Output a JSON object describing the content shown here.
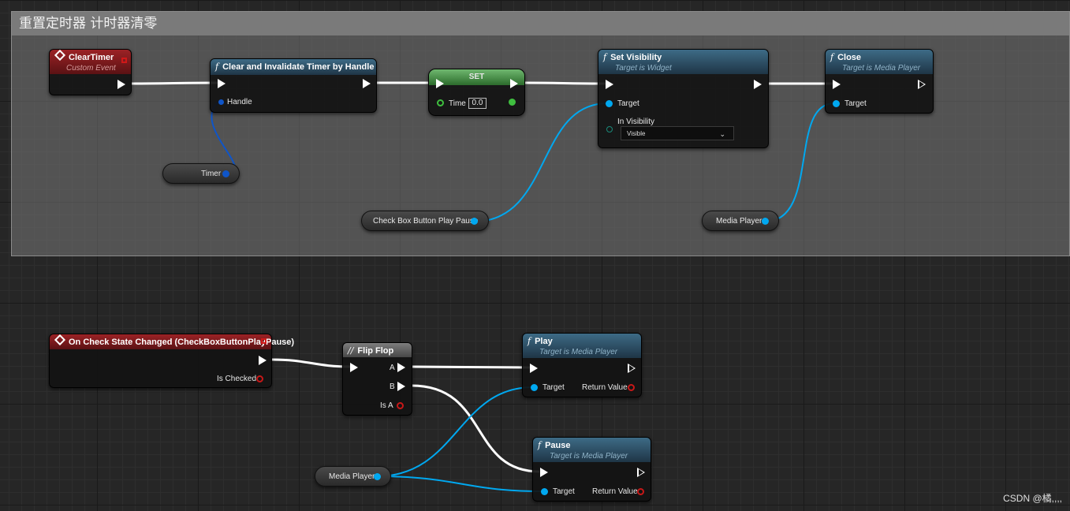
{
  "comment": {
    "title": "重置定时器 计时器清零"
  },
  "nodes": {
    "clear_timer": {
      "title": "ClearTimer",
      "subtitle": "Custom Event"
    },
    "clear_invalidate": {
      "title": "Clear and Invalidate Timer by Handle",
      "handle_label": "Handle"
    },
    "timer_var": {
      "label": "Timer"
    },
    "set_node": {
      "title": "SET",
      "time_label": "Time",
      "time_value": "0.0"
    },
    "set_visibility": {
      "title": "Set Visibility",
      "subtitle": "Target is Widget",
      "target_label": "Target",
      "in_visibility_label": "In Visibility",
      "in_visibility_value": "Visible"
    },
    "checkbox_var": {
      "label": "Check Box Button Play Pause"
    },
    "close_node": {
      "title": "Close",
      "subtitle": "Target is Media Player",
      "target_label": "Target"
    },
    "media_player_var_top": {
      "label": "Media Player"
    },
    "on_check_state": {
      "title": "On Check State Changed (CheckBoxButtonPlayPause)",
      "is_checked_label": "Is Checked"
    },
    "flip_flop": {
      "title": "Flip Flop",
      "a_label": "A",
      "b_label": "B",
      "is_a_label": "Is A"
    },
    "play_node": {
      "title": "Play",
      "subtitle": "Target is Media Player",
      "target_label": "Target",
      "return_label": "Return Value"
    },
    "pause_node": {
      "title": "Pause",
      "subtitle": "Target is Media Player",
      "target_label": "Target",
      "return_label": "Return Value"
    },
    "media_player_var_bottom": {
      "label": "Media Player"
    }
  },
  "icons": {
    "function": "f",
    "event": "diamond",
    "macro": "//"
  },
  "colors": {
    "exec": "#ffffff",
    "object": "#00a8f0",
    "boolean": "#c81818",
    "float": "#3fbf3f",
    "struct": "#0f55c8",
    "event_header": "#9c2225",
    "function_header": "#3d6b86"
  },
  "watermark": "CSDN @橘,,,,"
}
